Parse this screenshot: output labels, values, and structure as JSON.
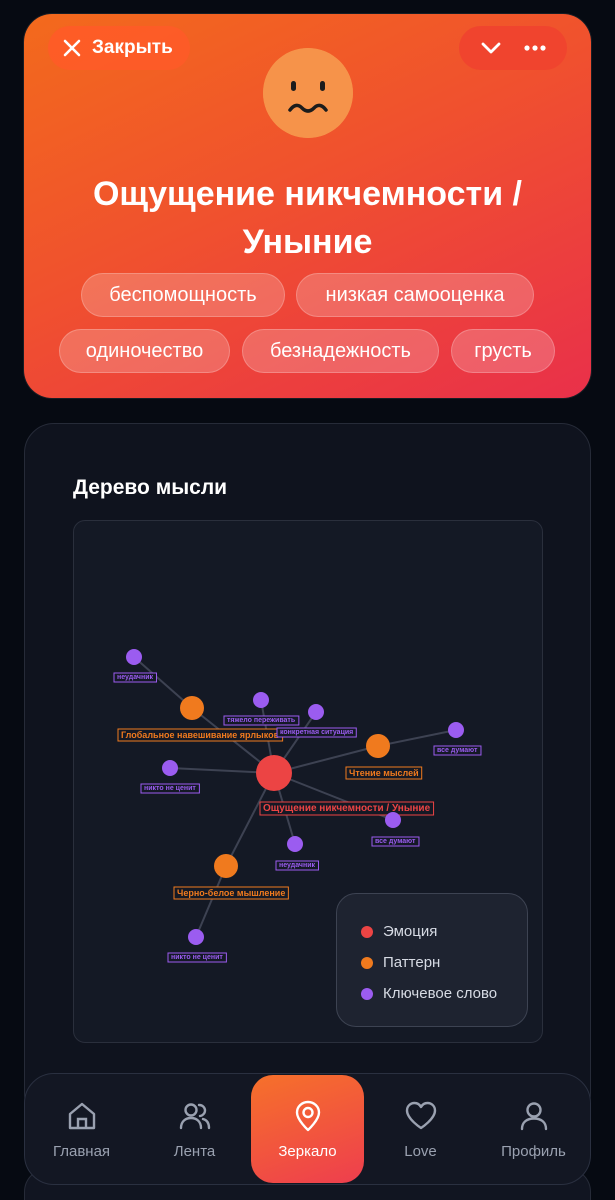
{
  "header": {
    "close_label": "Закрыть",
    "title_line1": "Ощущение никчемности /",
    "title_line2": "Уныние",
    "tags": [
      "беспомощность",
      "низкая самооценка",
      "одиночество",
      "безнадежность",
      "грусть"
    ]
  },
  "colors": {
    "emotion": "#ec4444",
    "pattern": "#f07a1e",
    "keyword": "#9b5cf0",
    "accent": "#f2532b"
  },
  "tree": {
    "title": "Дерево мысли",
    "nodes": [
      {
        "label": "Ощущение никчемности / Уныние",
        "type": "emotion"
      },
      {
        "label": "Глобальное навешивание ярлыков",
        "type": "pattern"
      },
      {
        "label": "Чтение мыслей",
        "type": "pattern"
      },
      {
        "label": "Черно-белое мышление",
        "type": "pattern"
      },
      {
        "label": "неудачник",
        "type": "keyword"
      },
      {
        "label": "тяжело переживать",
        "type": "keyword"
      },
      {
        "label": "конкретная ситуация",
        "type": "keyword"
      },
      {
        "label": "все думают",
        "type": "keyword"
      },
      {
        "label": "никто не ценит",
        "type": "keyword"
      },
      {
        "label": "все думают",
        "type": "keyword"
      },
      {
        "label": "неудачник",
        "type": "keyword"
      },
      {
        "label": "никто не ценит",
        "type": "keyword"
      }
    ],
    "legend": [
      {
        "label": "Эмоция",
        "type": "emotion"
      },
      {
        "label": "Паттерн",
        "type": "pattern"
      },
      {
        "label": "Ключевое слово",
        "type": "keyword"
      }
    ]
  },
  "nav": {
    "items": [
      {
        "label": "Главная",
        "icon": "home-icon"
      },
      {
        "label": "Лента",
        "icon": "users-icon"
      },
      {
        "label": "Зеркало",
        "icon": "location-icon"
      },
      {
        "label": "Love",
        "icon": "heart-icon"
      },
      {
        "label": "Профиль",
        "icon": "user-icon"
      }
    ],
    "active_index": 2
  }
}
